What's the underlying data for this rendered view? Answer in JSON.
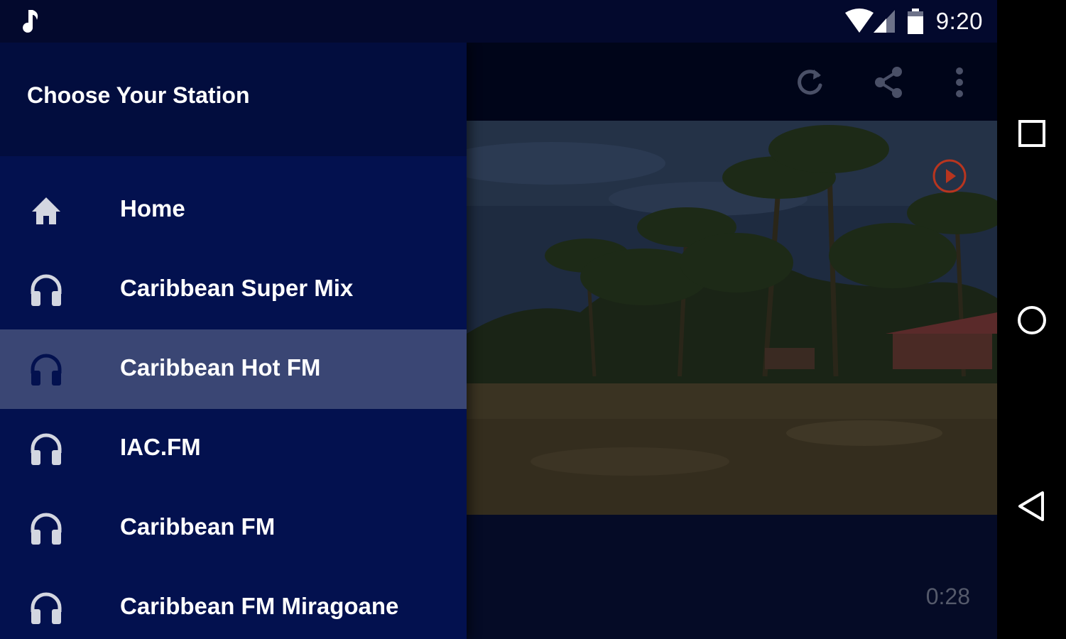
{
  "status_bar": {
    "time": "9:20",
    "icons": [
      "music-note-icon",
      "wifi-icon",
      "cell-signal-icon",
      "battery-icon"
    ]
  },
  "drawer": {
    "title": "Choose Your Station",
    "items": [
      {
        "label": "Home",
        "icon": "home-icon",
        "selected": false
      },
      {
        "label": "Caribbean Super Mix",
        "icon": "headphones-icon",
        "selected": false
      },
      {
        "label": "Caribbean Hot FM",
        "icon": "headphones-icon",
        "selected": true
      },
      {
        "label": "IAC.FM",
        "icon": "headphones-icon",
        "selected": false
      },
      {
        "label": "Caribbean FM",
        "icon": "headphones-icon",
        "selected": false
      },
      {
        "label": "Caribbean FM Miragoane",
        "icon": "headphones-icon",
        "selected": false
      }
    ]
  },
  "toolbar": {
    "icons": [
      "refresh-icon",
      "share-icon",
      "more-vert-icon"
    ]
  },
  "player": {
    "elapsed": "0:28",
    "play_icon": "play-circle-icon"
  },
  "navigation": {
    "icons": [
      "recents-square-icon",
      "home-circle-icon",
      "back-triangle-icon"
    ]
  },
  "colors": {
    "drawer_bg": "#03114f",
    "drawer_header_bg": "#020d3e",
    "selected_item_bg": "#3a4674",
    "play_accent": "#b8351f"
  }
}
